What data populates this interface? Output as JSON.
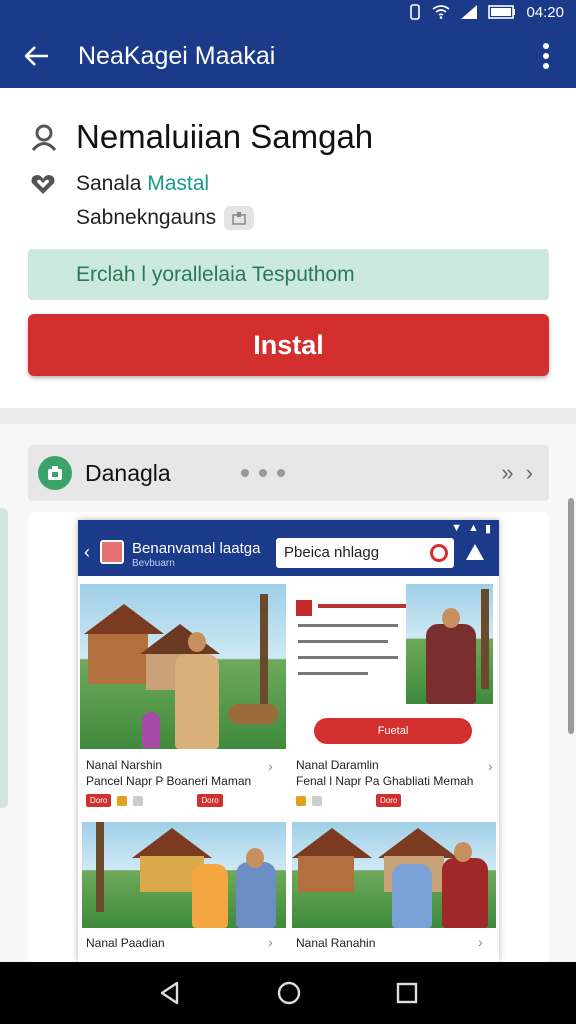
{
  "status": {
    "time": "04:20"
  },
  "app_bar": {
    "title": "NeaKagei Maakai"
  },
  "profile": {
    "name": "Nemaluiian Samgah",
    "sub_line_1": "Sanala",
    "sub_line_1_accent": "Mastal",
    "sub_line_2": "Sabnekngauns"
  },
  "promo": {
    "text": "Erclah l yorallelaia Tesputhom"
  },
  "install": {
    "label": "Instal"
  },
  "gallery": {
    "title": "Danagla"
  },
  "screenshot": {
    "title": "Benanvamal laatga",
    "subtitle": "Bevbuarn",
    "search_text": "Pbeica nhlagg",
    "promo_button": "Fuetal",
    "items": [
      {
        "title": "Nanal Narshin",
        "subtitle": "Pancel Napr P Boaneri Maman"
      },
      {
        "title": "Nanal Daramlin",
        "subtitle": "Fenal l Napr Pa Ghabliati Memah"
      },
      {
        "title": "Nanal Paadian",
        "subtitle": ""
      },
      {
        "title": "Nanal Ranahin",
        "subtitle": ""
      }
    ],
    "tag_label": "Doro"
  },
  "icons": [
    "back-arrow-icon",
    "more-vertical-icon",
    "person-icon",
    "heart-icon",
    "badge-icon",
    "gallery-icon",
    "search-icon",
    "bell-icon",
    "nav-back-icon",
    "nav-home-icon",
    "nav-recents-icon"
  ]
}
